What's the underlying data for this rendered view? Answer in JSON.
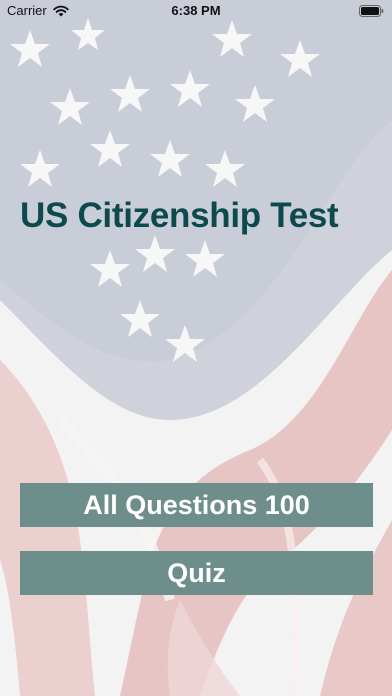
{
  "status_bar": {
    "carrier": "Carrier",
    "time": "6:38 PM",
    "icons": [
      "wifi-icon",
      "battery-icon"
    ]
  },
  "main": {
    "title": "US Citizenship Test",
    "buttons": {
      "all_questions_label": "All Questions 100",
      "quiz_label": "Quiz"
    }
  },
  "background": {
    "type": "american-flag-faded",
    "stripe_color": "#e9c2c2",
    "canton_color": "#c9ccd6"
  },
  "colors": {
    "title": "#0d4a4e",
    "button": "#6d8e8a",
    "button_text": "#ffffff"
  }
}
